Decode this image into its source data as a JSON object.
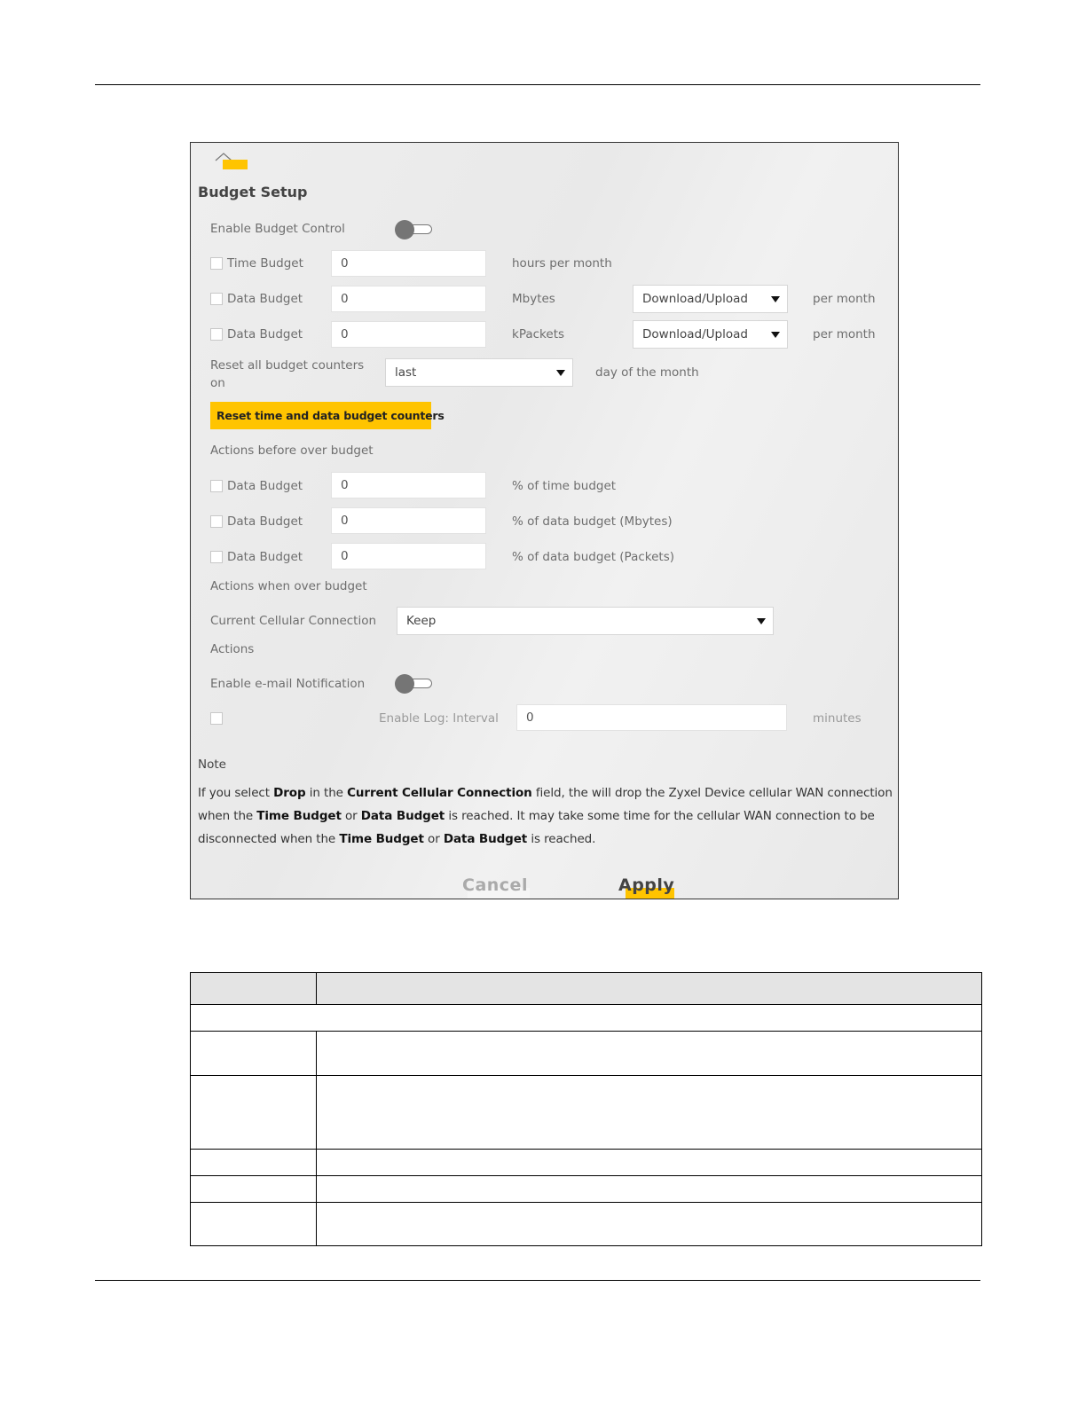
{
  "panel": {
    "title": "Budget Setup",
    "enable_budget_control": {
      "label": "Enable Budget Control",
      "enabled": false
    },
    "time_budget": {
      "label": "Time Budget",
      "checked": false,
      "value": "0",
      "unit": "hours per month"
    },
    "data_budget_mbytes": {
      "label": "Data Budget",
      "checked": false,
      "value": "0",
      "unit": "Mbytes",
      "direction": "Download/Upload",
      "suffix": "per month"
    },
    "data_budget_kpackets": {
      "label": "Data Budget",
      "checked": false,
      "value": "0",
      "unit": "kPackets",
      "direction": "Download/Upload",
      "suffix": "per month"
    },
    "reset_on": {
      "label": "Reset all budget counters on",
      "value": "last",
      "suffix": "day of the month"
    },
    "reset_button_label": "Reset time and data budget counters",
    "actions_before_title": "Actions before over budget",
    "before_time": {
      "label": "Data Budget",
      "checked": false,
      "value": "0",
      "unit": "% of time budget"
    },
    "before_data_mbytes": {
      "label": "Data Budget",
      "checked": false,
      "value": "0",
      "unit": "% of data budget (Mbytes)"
    },
    "before_data_packets": {
      "label": "Data Budget",
      "checked": false,
      "value": "0",
      "unit": "% of data budget (Packets)"
    },
    "actions_when_title": "Actions when over budget",
    "current_connection": {
      "label": "Current Cellular Connection",
      "value": "Keep"
    },
    "actions_label": "Actions",
    "email_notification": {
      "label": "Enable e-mail Notification",
      "enabled": false
    },
    "log_interval": {
      "checked": false,
      "label": "Enable Log: Interval",
      "value": "0",
      "unit": "minutes"
    },
    "note_title": "Note",
    "note": {
      "t1": "If you select ",
      "b1": "Drop",
      "t2": " in the ",
      "b2": "Current Cellular Connection",
      "t3": " field, the will drop the Zyxel Device cellular WAN connection when the ",
      "b3": "Time Budget",
      "t4": " or ",
      "b4": "Data Budget",
      "t5": " is reached. It may take some time for the cellular WAN connection to be disconnected when the ",
      "b5": "Time Budget",
      "t6": " or ",
      "b6": "Data Budget",
      "t7": " is reached."
    },
    "cancel_label": "Cancel",
    "apply_label": "Apply",
    "accent_color": "#ffc400"
  }
}
